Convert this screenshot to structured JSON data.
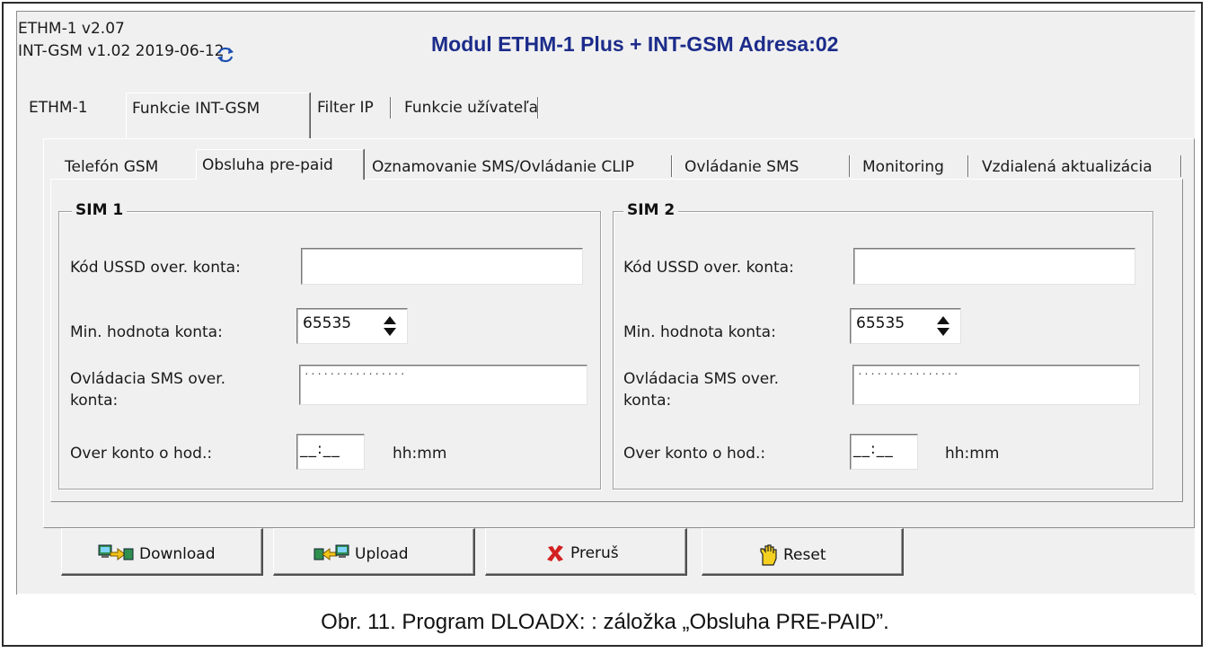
{
  "header": {
    "ethm_version": "ETHM-1 v2.07",
    "gsm_version": "INT-GSM v1.02 2019-06-12",
    "module_title": "Modul ETHM-1 Plus + INT-GSM Adresa:02"
  },
  "top_tabs": [
    "ETHM-1",
    "Funkcie INT-GSM",
    "Filter IP",
    "Funkcie užívateľa"
  ],
  "sub_tabs": [
    "Telefón GSM",
    "Obsluha pre-paid",
    "Oznamovanie SMS/Ovládanie CLIP",
    "Ovládanie SMS",
    "Monitoring",
    "Vzdialená aktualizácia"
  ],
  "sim1": {
    "title": "SIM 1",
    "ussd_label": "Kód USSD over. konta:",
    "ussd_value": "",
    "min_label": "Min. hodnota konta:",
    "min_value": "65535",
    "sms_label_line1": "Ovládacia SMS over.",
    "sms_label_line2": "konta:",
    "sms_value": "················",
    "check_label": "Over konto o hod.:",
    "check_value": "__:__",
    "time_hint": "hh:mm"
  },
  "sim2": {
    "title": "SIM 2",
    "ussd_label": "Kód USSD over. konta:",
    "ussd_value": "",
    "min_label": "Min. hodnota konta:",
    "min_value": "65535",
    "sms_label_line1": "Ovládacia SMS over.",
    "sms_label_line2": "konta:",
    "sms_value": "················",
    "check_label": "Over konto o hod.:",
    "check_value": "__:__",
    "time_hint": "hh:mm"
  },
  "buttons": {
    "download": "Download",
    "upload": "Upload",
    "interrupt": "Preruš",
    "reset": "Reset"
  },
  "caption": "Obr. 11. Program DLOADX: : záložka „Obsluha PRE-PAID”.",
  "colors": {
    "title_blue": "#1c2c8a",
    "window_bg": "#f0f0f0",
    "cancel_red": "#d32020"
  }
}
